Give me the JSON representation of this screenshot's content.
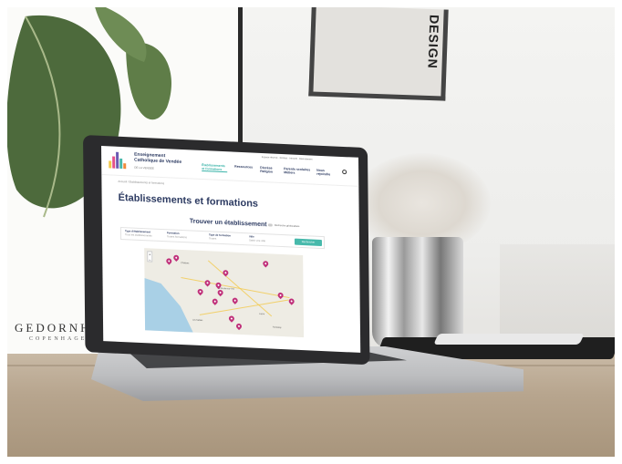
{
  "scene": {
    "poster_brand": "GEDORNH",
    "poster_sub": "COPENHAGEN",
    "frame_text": "DESIGN"
  },
  "site": {
    "brand": {
      "line1": "Enseignement",
      "line2": "Catholique de Vendée",
      "sub": "DE LA VENDÉE"
    },
    "nav": [
      {
        "label": "Établissements et formations",
        "active": true
      },
      {
        "label": "Ressources",
        "active": false
      },
      {
        "label": "Diocèse Religion",
        "active": false
      },
      {
        "label": "Parents scolaires Métiers",
        "active": false
      },
      {
        "label": "Nous rejoindre",
        "active": false
      }
    ],
    "top_links": "Espace réservé · Contact · Intranet · Recrutement",
    "breadcrumb": "Accueil / Établissements et formations",
    "page_title": "Établissements et formations",
    "section_title": "Trouver un établissement",
    "toggle_label": "Recherche géolocalisée",
    "filters": [
      {
        "label": "Type d'établissement",
        "value": "Tous les établissements"
      },
      {
        "label": "Formation",
        "value": "Toutes formations"
      },
      {
        "label": "Type de formation",
        "value": "Toutes"
      },
      {
        "label": "Ville",
        "value": "Saisir une ville"
      }
    ],
    "search_button": "Rechercher",
    "map": {
      "zoom_in": "+",
      "zoom_out": "−",
      "towns": [
        "La Roche-sur-Yon",
        "Luçon",
        "Les Sables",
        "Challans",
        "Fontenay"
      ],
      "pin_color": "#c0307a",
      "sea_color": "#a9d0e6"
    }
  }
}
